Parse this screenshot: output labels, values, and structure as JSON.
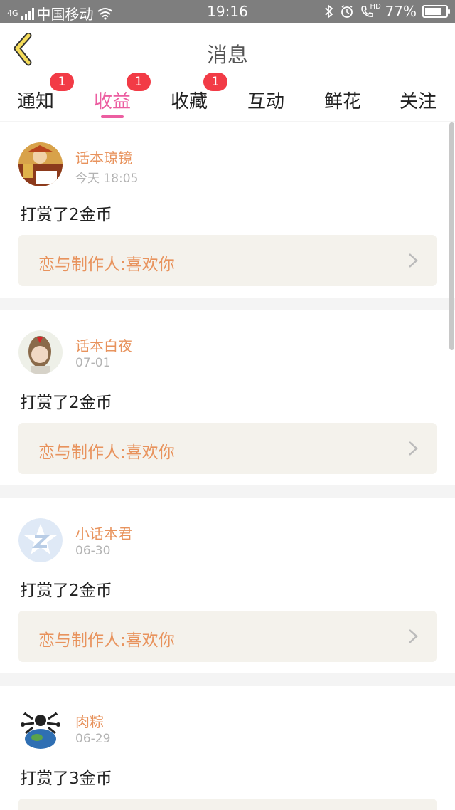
{
  "status_bar": {
    "network": "4G",
    "carrier": "中国移动",
    "time": "19:16",
    "hd": "HD",
    "battery_percent": "77%",
    "battery_level": 0.77
  },
  "header": {
    "title": "消息",
    "accent_color": "#ec5ea1"
  },
  "tabs": [
    {
      "label": "通知",
      "badge": "1",
      "active": false
    },
    {
      "label": "收益",
      "badge": "1",
      "active": true
    },
    {
      "label": "收藏",
      "badge": "1",
      "active": false
    },
    {
      "label": "互动",
      "badge": "",
      "active": false
    },
    {
      "label": "鲜花",
      "badge": "",
      "active": false
    },
    {
      "label": "关注",
      "badge": "",
      "active": false
    }
  ],
  "messages": [
    {
      "user": "话本琼镜",
      "time": "今天 18:05",
      "text": "打赏了2金币",
      "link": "恋与制作人:喜欢你",
      "avatar_icon": "avatar-illustration-icon"
    },
    {
      "user": "话本白夜",
      "time": "07-01",
      "text": "打赏了2金币",
      "link": "恋与制作人:喜欢你",
      "avatar_icon": "avatar-girl-icon"
    },
    {
      "user": "小话本君",
      "time": "06-30",
      "text": "打赏了2金币",
      "link": "恋与制作人:喜欢你",
      "avatar_icon": "avatar-default-z-icon"
    },
    {
      "user": "肉粽",
      "time": "06-29",
      "text": "打赏了3金币",
      "link": "",
      "avatar_icon": "avatar-globe-icon"
    }
  ]
}
